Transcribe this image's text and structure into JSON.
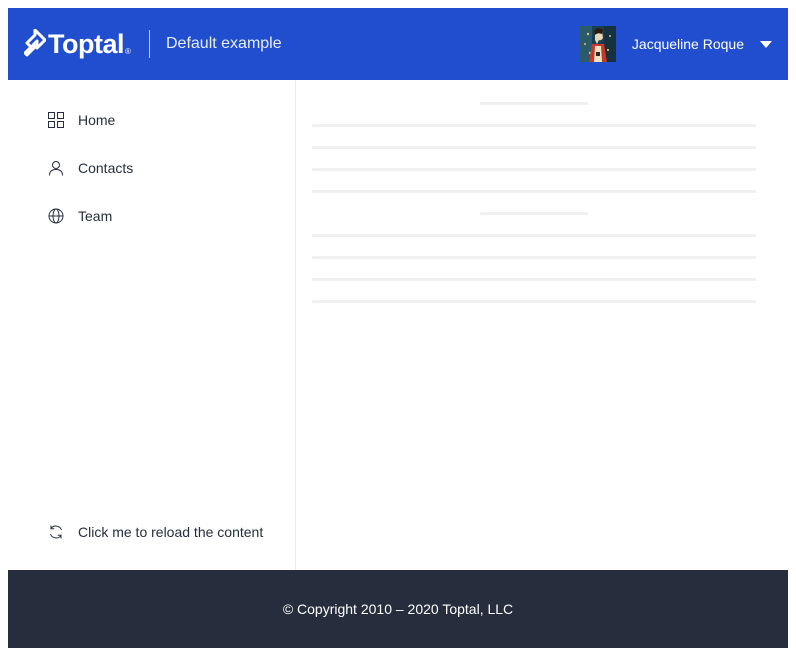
{
  "header": {
    "logo_text": "Toptal",
    "logo_mark": "®",
    "title": "Default example",
    "user": {
      "name": "Jacqueline Roque",
      "avatar_icon": "avatar-image",
      "menu_icon": "caret-down-icon"
    }
  },
  "sidebar": {
    "items": [
      {
        "label": "Home",
        "icon": "grid-icon"
      },
      {
        "label": "Contacts",
        "icon": "person-icon"
      },
      {
        "label": "Team",
        "icon": "globe-icon"
      }
    ],
    "reload": {
      "label": "Click me to reload the content",
      "icon": "refresh-icon"
    }
  },
  "footer": {
    "copyright": "© Copyright 2010 – 2020 Toptal, LLC"
  },
  "colors": {
    "header_bg": "#204ecf",
    "footer_bg": "#262d3d",
    "text": "#262d3d",
    "skeleton": "#eef0f2"
  }
}
